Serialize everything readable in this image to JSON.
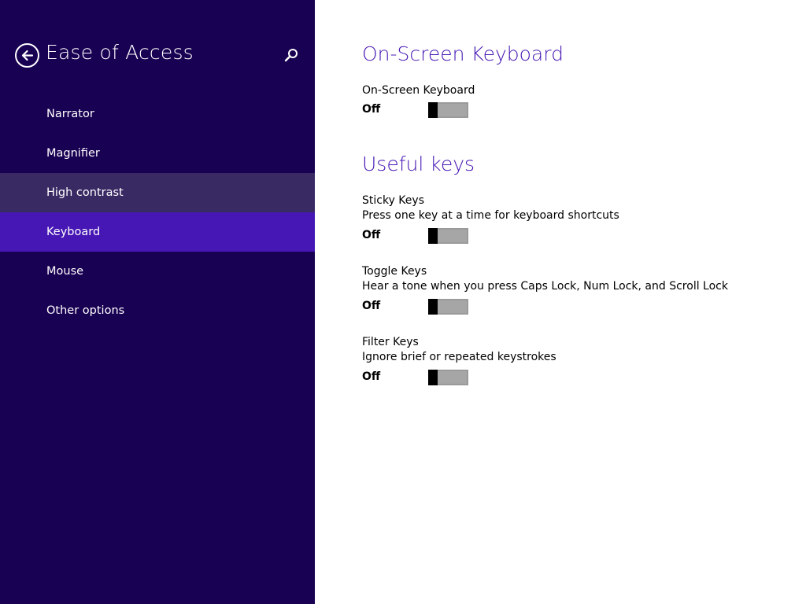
{
  "sidebar": {
    "title": "Ease of Access",
    "items": [
      {
        "label": "Narrator",
        "state": "normal"
      },
      {
        "label": "Magnifier",
        "state": "normal"
      },
      {
        "label": "High contrast",
        "state": "hover"
      },
      {
        "label": "Keyboard",
        "state": "selected"
      },
      {
        "label": "Mouse",
        "state": "normal"
      },
      {
        "label": "Other options",
        "state": "normal"
      }
    ],
    "icons": {
      "back": "back-arrow-icon",
      "search": "search-icon"
    }
  },
  "main": {
    "sections": [
      {
        "title": "On-Screen Keyboard",
        "settings": [
          {
            "label": "On-Screen Keyboard",
            "state": "Off",
            "on": false
          }
        ]
      },
      {
        "title": "Useful keys",
        "settings": [
          {
            "label": "Sticky Keys",
            "description": "Press one key at a time for keyboard shortcuts",
            "state": "Off",
            "on": false
          },
          {
            "label": "Toggle Keys",
            "description": "Hear a tone when you press Caps Lock, Num Lock, and Scroll Lock",
            "state": "Off",
            "on": false
          },
          {
            "label": "Filter Keys",
            "description": "Ignore brief or repeated keystrokes",
            "state": "Off",
            "on": false
          }
        ]
      }
    ]
  },
  "colors": {
    "sidebar_bg": "#180052",
    "accent": "#4617b4",
    "hover": "#3a2a64",
    "toggle_off": "#a6a6a6"
  }
}
